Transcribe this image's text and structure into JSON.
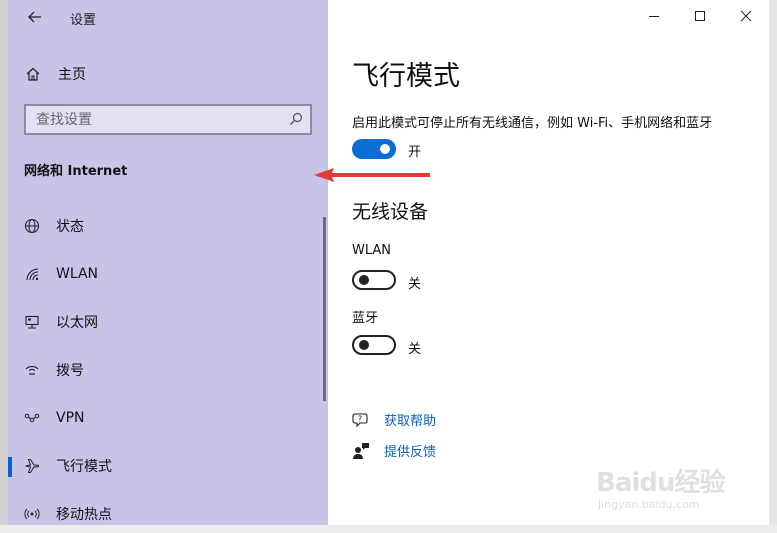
{
  "window": {
    "title": "设置"
  },
  "sidebar": {
    "home_label": "主页",
    "search_placeholder": "查找设置",
    "section_title": "网络和 Internet",
    "items": [
      {
        "label": "状态",
        "icon": "globe-icon"
      },
      {
        "label": "WLAN",
        "icon": "wifi-icon"
      },
      {
        "label": "以太网",
        "icon": "ethernet-icon"
      },
      {
        "label": "拨号",
        "icon": "dialup-icon"
      },
      {
        "label": "VPN",
        "icon": "vpn-icon"
      },
      {
        "label": "飞行模式",
        "icon": "airplane-icon",
        "active": true
      },
      {
        "label": "移动热点",
        "icon": "hotspot-icon"
      }
    ]
  },
  "main": {
    "title": "飞行模式",
    "description": "启用此模式可停止所有无线通信，例如 Wi-Fi、手机网络和蓝牙",
    "airplane_toggle": {
      "state": "开",
      "on": true
    },
    "wireless_section_title": "无线设备",
    "wlan": {
      "label": "WLAN",
      "state": "关",
      "on": false
    },
    "bluetooth": {
      "label": "蓝牙",
      "state": "关",
      "on": false
    },
    "links": {
      "help": "获取帮助",
      "feedback": "提供反馈"
    }
  },
  "watermark": {
    "brand": "Baidu经验",
    "url": "jingyan.baidu.com"
  },
  "colors": {
    "sidebar_bg": "#c7c4e7",
    "accent": "#0a6ed6",
    "link": "#0a5fc0",
    "annotation_arrow": "#e53935"
  }
}
